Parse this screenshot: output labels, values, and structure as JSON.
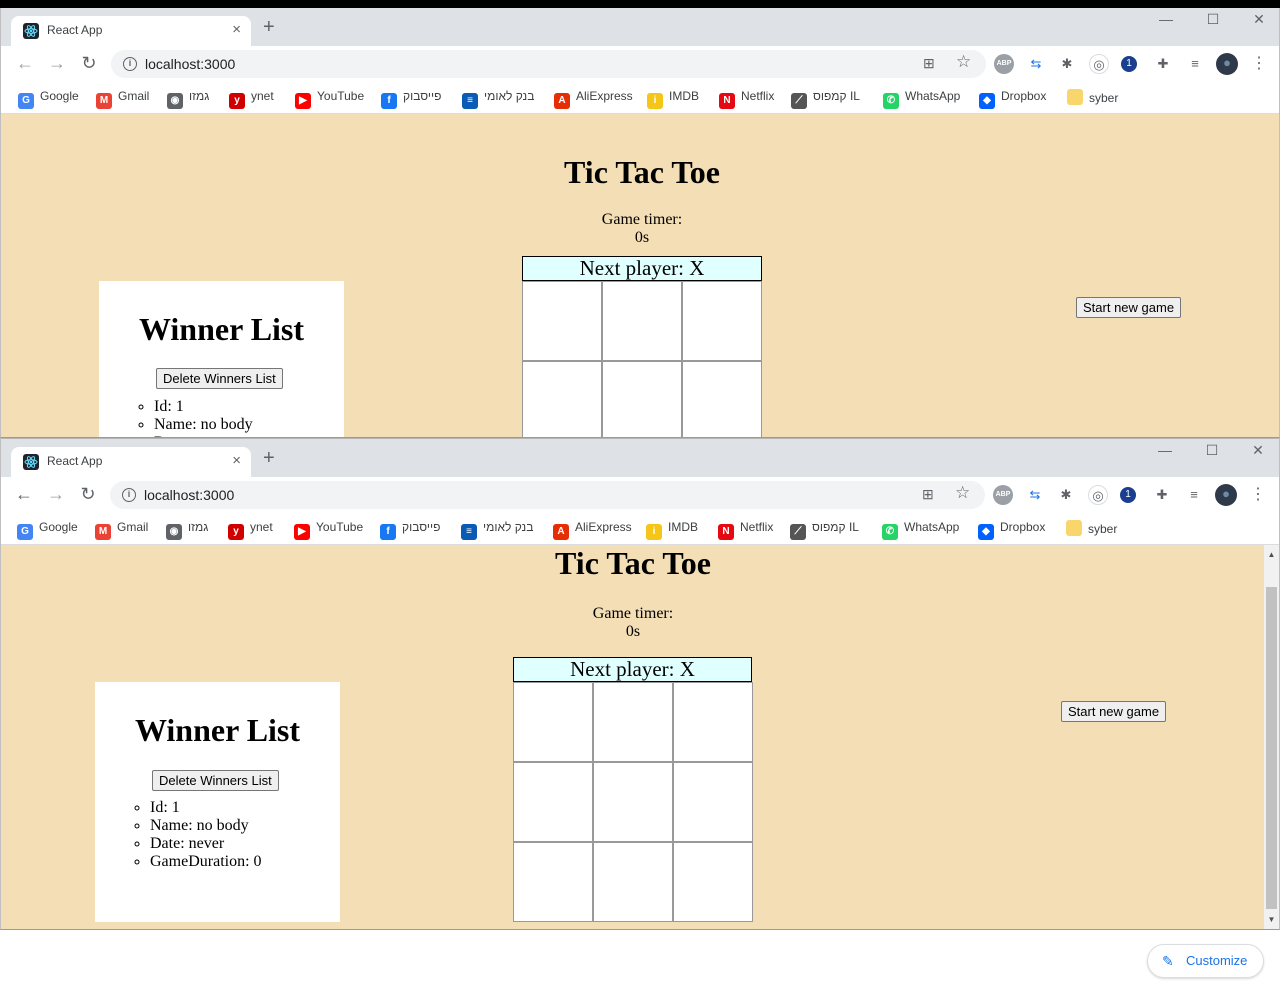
{
  "browser": {
    "tab_title": "React App",
    "new_tab": "+",
    "close_tab": "×",
    "url": "localhost:3000",
    "back": "←",
    "forward": "→",
    "reload": "↻",
    "translate": "⊞",
    "star": "☆",
    "menu": "⋮",
    "minimize": "—",
    "maximize": "☐",
    "close": "✕",
    "extensions": [
      "ABP",
      "⇆",
      "✱",
      "◎",
      "1",
      "✚",
      "≡",
      "●"
    ]
  },
  "bookmarks": [
    {
      "label": "Google",
      "icon": "google-icon",
      "color": "#4285f4",
      "glyph": "G"
    },
    {
      "label": "Gmail",
      "icon": "gmail-icon",
      "color": "#ea4335",
      "glyph": "M"
    },
    {
      "label": "גמזו",
      "icon": "globe-icon",
      "color": "#5f6368",
      "glyph": "◉"
    },
    {
      "label": "ynet",
      "icon": "ynet-icon",
      "color": "#d00000",
      "glyph": "y"
    },
    {
      "label": "YouTube",
      "icon": "youtube-icon",
      "color": "#ff0000",
      "glyph": "▶"
    },
    {
      "label": "פייסבוק",
      "icon": "facebook-icon",
      "color": "#1877f2",
      "glyph": "f"
    },
    {
      "label": "בנק לאומי",
      "icon": "leumi-icon",
      "color": "#0a5bb5",
      "glyph": "≡"
    },
    {
      "label": "AliExpress",
      "icon": "aliexpress-icon",
      "color": "#e62e04",
      "glyph": "A"
    },
    {
      "label": "IMDB",
      "icon": "imdb-icon",
      "color": "#f5c518",
      "glyph": "i"
    },
    {
      "label": "Netflix",
      "icon": "netflix-icon",
      "color": "#e50914",
      "glyph": "N"
    },
    {
      "label": "קמפוס IL",
      "icon": "campus-icon",
      "color": "#555555",
      "glyph": "⟋"
    },
    {
      "label": "WhatsApp",
      "icon": "whatsapp-icon",
      "color": "#25d366",
      "glyph": "✆"
    },
    {
      "label": "Dropbox",
      "icon": "dropbox-icon",
      "color": "#0061ff",
      "glyph": "◆"
    },
    {
      "label": "syber",
      "icon": "folder-icon",
      "color": "#f9d66c",
      "glyph": " "
    }
  ],
  "game": {
    "title": "Tic Tac Toe",
    "timer_label": "Game timer:",
    "timer_value": "0s",
    "status": "Next player: X",
    "start_button": "Start new game",
    "cells": [
      "",
      "",
      "",
      "",
      "",
      "",
      "",
      "",
      ""
    ]
  },
  "winners": {
    "heading": "Winner List",
    "delete_button": "Delete Winners List",
    "items": [
      "Id: 1",
      "Name: no body",
      "Date: never",
      "GameDuration: 0"
    ]
  },
  "customize": {
    "label": "Customize",
    "icon": "pencil-icon"
  },
  "colors": {
    "page_bg": "#f3deb5",
    "status_bg": "#e0ffff",
    "accent": "#1a73e8"
  }
}
